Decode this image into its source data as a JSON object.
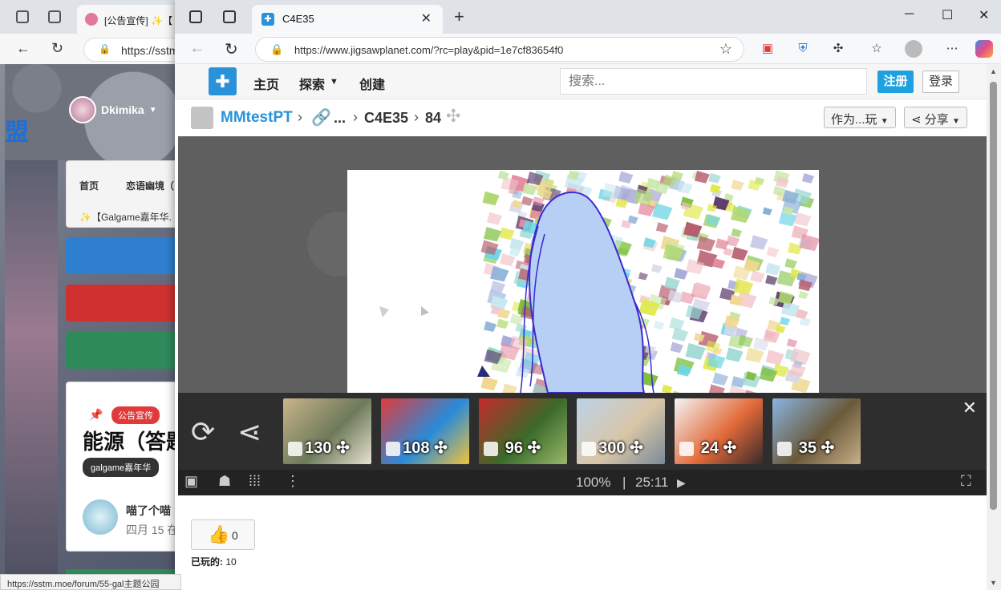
{
  "back_window": {
    "tab_title": "[公告宣传] ✨【",
    "url": "https://sstm",
    "username": "Dkimika",
    "badge_char": "盟",
    "breadcrumb_home": "首页",
    "breadcrumb_section": "恋语幽境（",
    "breadcrumb_sub": "✨【Galgame嘉年华.",
    "post_tag": "公告宣传",
    "post_title": "能源（答题",
    "post_chip": "galgame嘉年华",
    "comment_text": "喵了个喵",
    "comment_date": "四月 15 在",
    "status_url": "https://sstm.moe/forum/55-gal主题公园"
  },
  "tab": {
    "title": "C4E35"
  },
  "address": {
    "url": "https://www.jigsawplanet.com/?rc=play&pid=1e7cf83654f0"
  },
  "site_nav": {
    "home": "主页",
    "explore": "探索",
    "create": "创建",
    "search_placeholder": "搜索...",
    "register": "注册",
    "login": "登录"
  },
  "breadcrumb": {
    "user": "MMtestPT",
    "collection": "...",
    "puzzle_name": "C4E35",
    "piece_count": "84",
    "play_as": "作为...玩",
    "share": "分享"
  },
  "recommendations": [
    {
      "pieces": "130",
      "colors": [
        "#c9b48a",
        "#6d7a5a",
        "#e8e2d2"
      ]
    },
    {
      "pieces": "108",
      "colors": [
        "#e23a3a",
        "#2a8ad8",
        "#f2c23a"
      ]
    },
    {
      "pieces": "96",
      "colors": [
        "#c62a2a",
        "#3a6a2a",
        "#9ab86a"
      ]
    },
    {
      "pieces": "300",
      "colors": [
        "#bcd2ea",
        "#d8c6a6",
        "#7a8a9a"
      ]
    },
    {
      "pieces": "24",
      "colors": [
        "#f4f4f4",
        "#e26a3a",
        "#3a2a2a"
      ]
    },
    {
      "pieces": "35",
      "colors": [
        "#8ab4e2",
        "#6a5a3a",
        "#c8b08a"
      ]
    }
  ],
  "controls": {
    "zoom": "100%",
    "separator": "|",
    "timer": "25:11"
  },
  "likes": {
    "count": "0"
  },
  "played": {
    "label": "已玩的:",
    "count": "10"
  }
}
